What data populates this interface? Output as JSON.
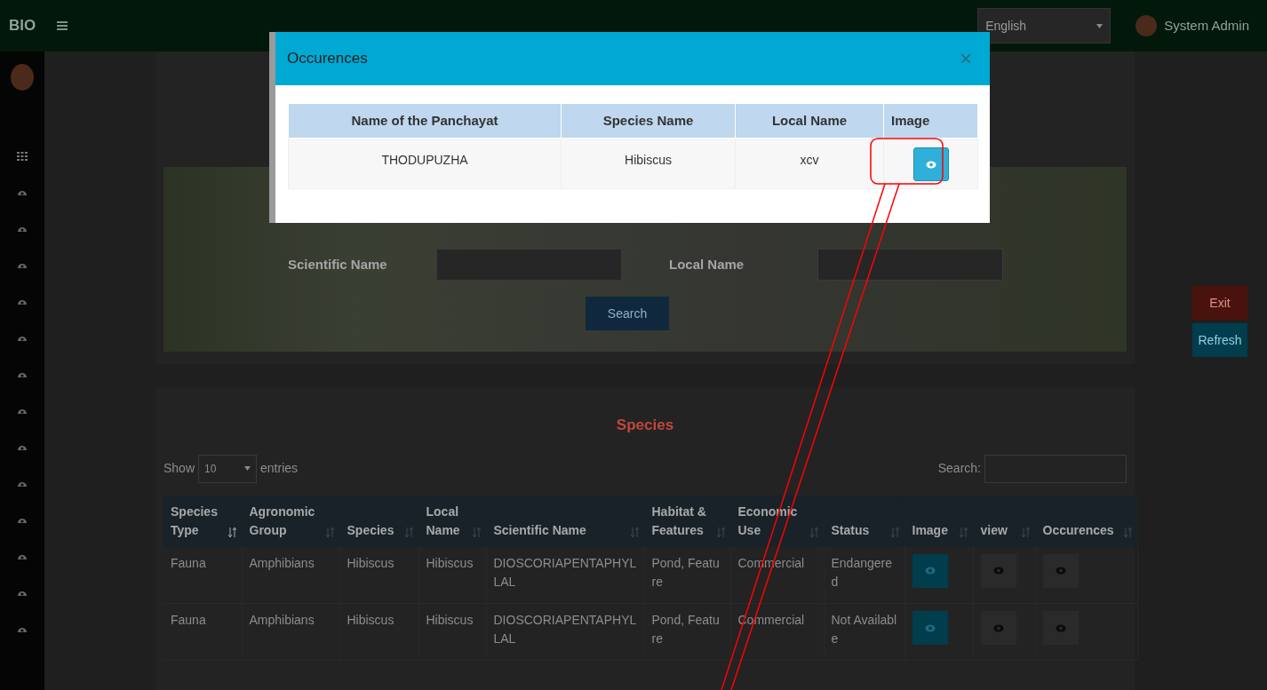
{
  "topbar": {
    "brand": "BIO",
    "language": "English",
    "user_name": "System Admin"
  },
  "search_form": {
    "fields": [
      {
        "label": "Scientific Name"
      },
      {
        "label": "Local Name"
      }
    ],
    "search_button": "Search"
  },
  "side_buttons": [
    {
      "label": "Exit",
      "kind": "danger"
    },
    {
      "label": "Refresh",
      "kind": "info"
    }
  ],
  "species_panel": {
    "title": "Species",
    "show_label": "Show",
    "entries_value": "10",
    "entries_label": "entries",
    "search_label": "Search:",
    "columns": [
      "Species Type",
      "Agronomic Group",
      "Species",
      "Local Name",
      "Scientific Name",
      "Habitat & Features",
      "Economic Use",
      "Status",
      "Image",
      "view",
      "Occurences"
    ],
    "rows": [
      {
        "cells": [
          "Fauna",
          "Amphibians",
          "Hibiscus",
          "Hibiscus",
          "DIOSCORIAPENTAPHYLLAL",
          "Pond, Feature",
          "Commercial",
          "Endangered"
        ]
      },
      {
        "cells": [
          "Fauna",
          "Amphibians",
          "Hibiscus",
          "Hibiscus",
          "DIOSCORIAPENTAPHYLLAL",
          "Pond, Feature",
          "Commercial",
          "Not Available"
        ]
      }
    ]
  },
  "modal": {
    "title": "Occurences",
    "close": "×",
    "columns": [
      "Name of the Panchayat",
      "Species Name",
      "Local Name",
      "Image"
    ],
    "rows": [
      {
        "cells": [
          "THODUPUZHA",
          "Hibiscus",
          "xcv"
        ]
      }
    ]
  }
}
